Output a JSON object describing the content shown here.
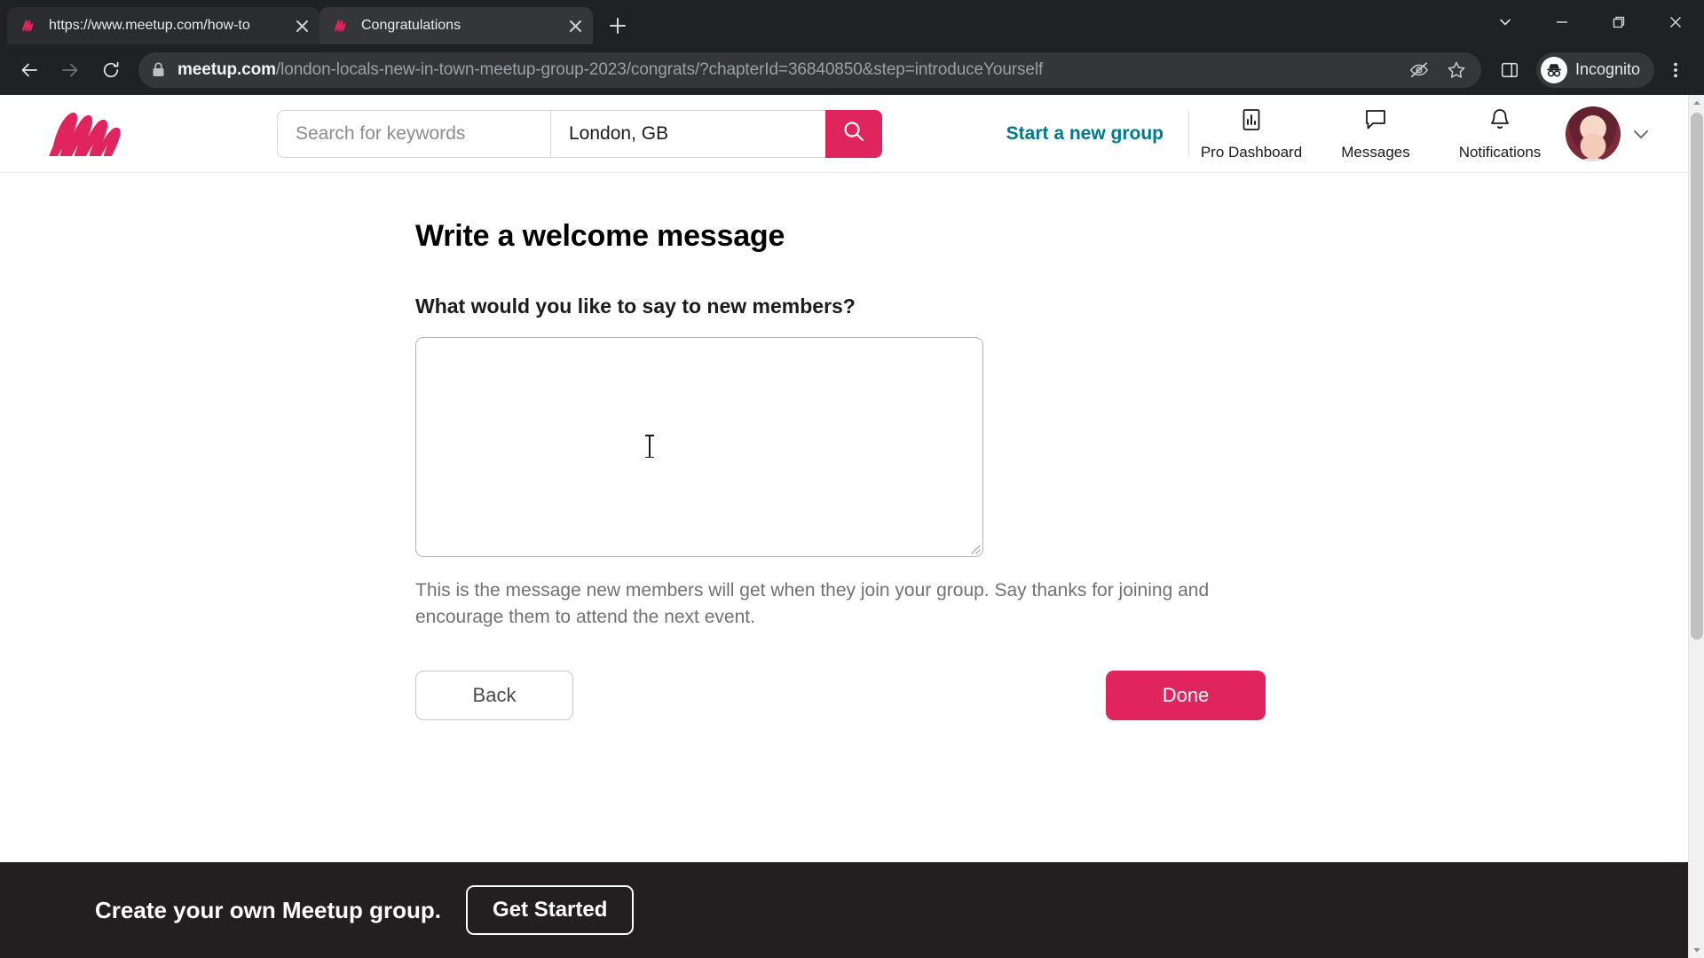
{
  "browser": {
    "tabs": [
      {
        "title": "https://www.meetup.com/how-to",
        "favicon": "meetup-icon",
        "active": false
      },
      {
        "title": "Congratulations",
        "favicon": "meetup-icon",
        "active": true
      }
    ],
    "new_tab_label": "+",
    "window_controls": [
      "tab-search-chevron",
      "minimize",
      "maximize",
      "close"
    ],
    "nav": {
      "back": "back-arrow",
      "forward": "forward-arrow",
      "reload": "reload-arrow"
    },
    "omnibox": {
      "host": "meetup.com",
      "path": "/london-locals-new-in-town-meetup-group-2023/congrats/?chapterId=36840850&step=introduceYourself",
      "full_url": "meetup.com/london-locals-new-in-town-meetup-group-2023/congrats/?chapterId=36840850&step=introduceYourself",
      "lock_icon": "lock-icon"
    },
    "toolbar_icons": [
      "third-party-cookie-blocked-icon",
      "bookmark-star-icon",
      "side-panel-icon",
      "chrome-menu-icon"
    ],
    "profile": {
      "label": "Incognito",
      "icon": "incognito-icon"
    }
  },
  "site_header": {
    "logo_text": "Meetup",
    "search": {
      "keyword_placeholder": "Search for keywords",
      "keyword_value": "",
      "location_value": "London, GB",
      "search_button_icon": "search-icon"
    },
    "start_a_new_group": "Start a new group",
    "nav_items": [
      {
        "label": "Pro Dashboard",
        "icon": "chart-bar-icon"
      },
      {
        "label": "Messages",
        "icon": "message-bubble-icon"
      },
      {
        "label": "Notifications",
        "icon": "bell-icon"
      }
    ],
    "avatar_alt": "user-avatar",
    "account_chevron": "chevron-down-icon"
  },
  "main": {
    "title": "Write a welcome message",
    "field_label": "What would you like to say to new members?",
    "textarea_value": "",
    "help_text": "This is the message new members will get when they join your group. Say thanks for joining and encourage them to attend the next event.",
    "back_button": "Back",
    "done_button": "Done"
  },
  "footer": {
    "text": "Create your own Meetup group.",
    "button": "Get Started"
  },
  "colors": {
    "brand_red": "#e0245e",
    "teal_link": "#00798a",
    "footer_bg": "#231f20",
    "chrome_bg": "#202124"
  }
}
